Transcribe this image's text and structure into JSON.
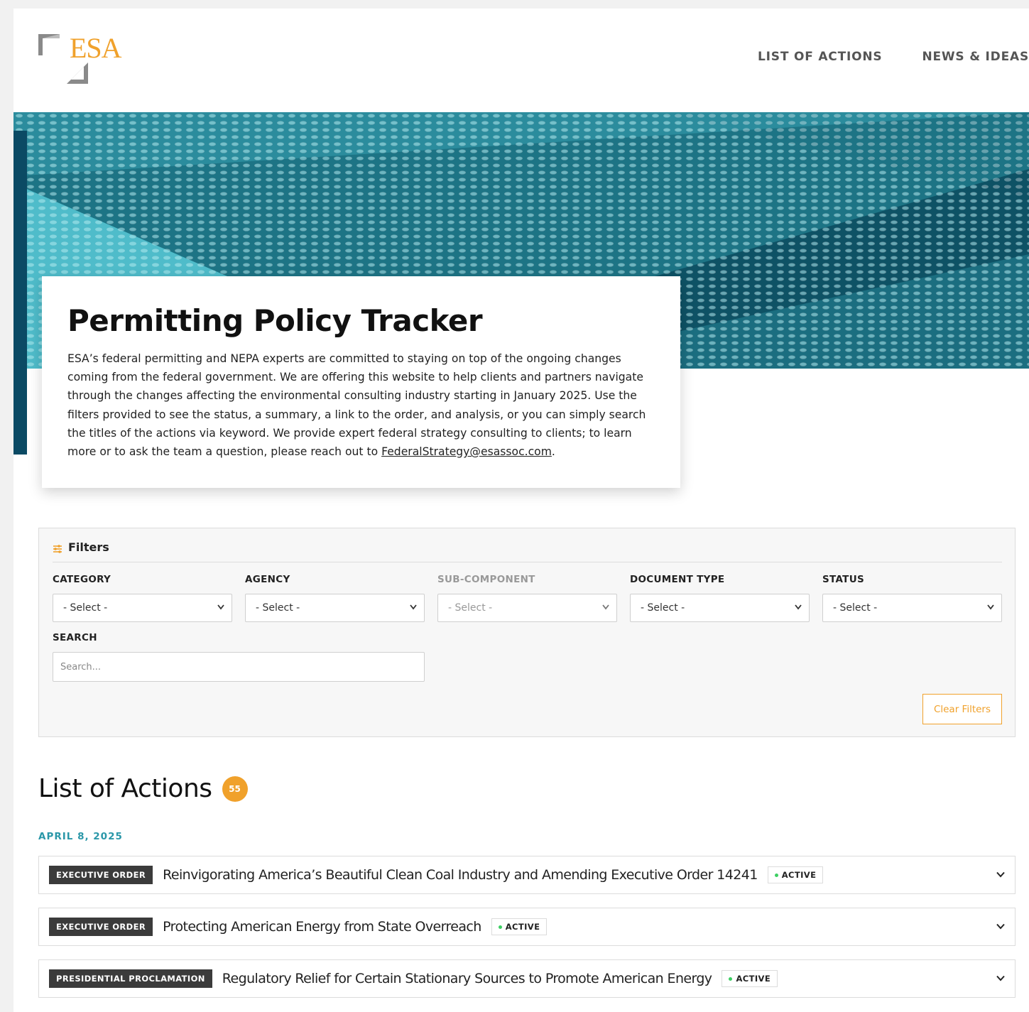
{
  "brand": {
    "logo_text": "ESA",
    "accent": "#f0a12b",
    "teal": "#2a97a8",
    "dark_teal": "#0b4a64"
  },
  "nav": {
    "items": [
      "LIST OF ACTIONS",
      "NEWS & IDEAS"
    ]
  },
  "intro": {
    "title": "Permitting Policy Tracker",
    "body": "ESA’s federal permitting and NEPA experts are committed to staying on top of the ongoing changes coming from the federal government. We are offering this website to help clients and partners navigate through the changes affecting the environmental consulting industry starting in January 2025. Use the filters provided to see the status, a summary, a link to the order, and analysis, or you can simply search the titles of the actions via keyword. We provide expert federal strategy consulting to clients; to learn more or to ask the team a question, please reach out to ",
    "email": "FederalStrategy@esassoc.com",
    "body_end": "."
  },
  "filters": {
    "heading": "Filters",
    "icon": "sliders-icon",
    "fields": [
      {
        "label": "CATEGORY",
        "value": "- Select -",
        "disabled": false
      },
      {
        "label": "AGENCY",
        "value": "- Select -",
        "disabled": false
      },
      {
        "label": "SUB-COMPONENT",
        "value": "- Select -",
        "disabled": true
      },
      {
        "label": "DOCUMENT TYPE",
        "value": "- Select -",
        "disabled": false
      },
      {
        "label": "STATUS",
        "value": "- Select -",
        "disabled": false
      }
    ],
    "search_label": "SEARCH",
    "search_placeholder": "Search...",
    "clear_label": "Clear Filters"
  },
  "list": {
    "title": "List of Actions",
    "count": "55",
    "date": "APRIL 8, 2025",
    "actions": [
      {
        "type": "EXECUTIVE ORDER",
        "title": "Reinvigorating America’s Beautiful Clean Coal Industry and Amending Executive Order 14241",
        "status": "ACTIVE"
      },
      {
        "type": "EXECUTIVE ORDER",
        "title": "Protecting American Energy from State Overreach",
        "status": "ACTIVE"
      },
      {
        "type": "PRESIDENTIAL PROCLAMATION",
        "title": "Regulatory Relief for Certain Stationary Sources to Promote American Energy",
        "status": "ACTIVE"
      }
    ]
  }
}
